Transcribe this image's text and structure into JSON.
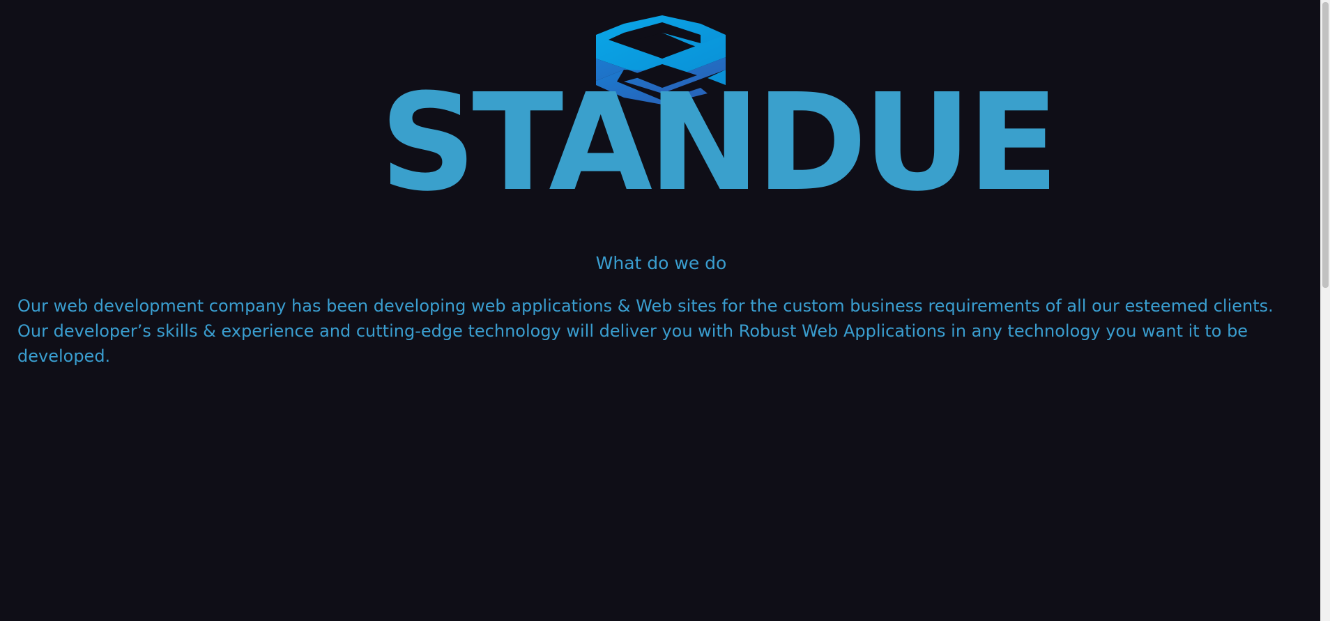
{
  "brand": {
    "logo_icon": "stacked-s-logo-icon",
    "name": "STANDUE",
    "colors": {
      "text": "#3aa0cc",
      "gradient_light": "#0aa5e6",
      "gradient_dark": "#1f68c2"
    }
  },
  "section": {
    "title": "What do we do",
    "description": "Our web development company has been developing web applications & Web sites for the custom business requirements of all our esteemed clients. Our developer’s skills & experience and cutting-edge technology will deliver you with Robust Web Applications in any technology you want it to be developed."
  },
  "theme": {
    "background": "#0f0e17",
    "text": "#3a9ed0"
  }
}
